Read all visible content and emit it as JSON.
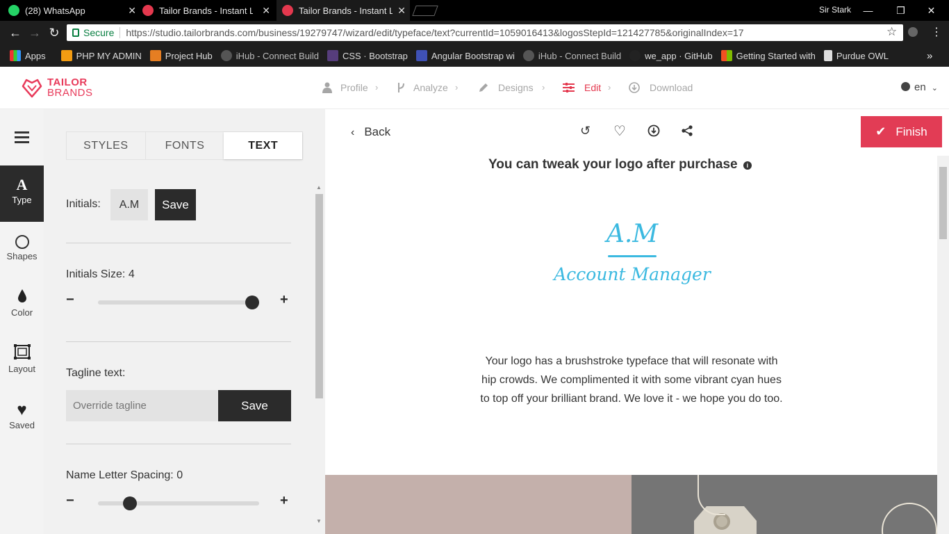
{
  "browser": {
    "tabs": [
      {
        "title": "(28) WhatsApp",
        "badge": "28"
      },
      {
        "title": "Tailor Brands - Instant Logo"
      },
      {
        "title": "Tailor Brands - Instant Logo"
      }
    ],
    "user": "Sir Stark",
    "secure_label": "Secure",
    "url": "https://studio.tailorbrands.com/business/19279747/wizard/edit/typeface/text?currentId=1059016413&logosStepId=121427785&originalIndex=17",
    "bookmarks": [
      "Apps",
      "PHP MY ADMIN",
      "Project Hub",
      "iHub - Connect Build",
      "CSS · Bootstrap",
      "Angular Bootstrap wi",
      "iHub - Connect Build",
      "we_app · GitHub",
      "Getting Started with",
      "Purdue OWL"
    ],
    "more": "»"
  },
  "header": {
    "logo_line1": "TAILOR",
    "logo_line2": "BRANDS",
    "steps": [
      "Profile",
      "Analyze",
      "Designs",
      "Edit",
      "Download"
    ],
    "active_step": "Edit",
    "language": "en",
    "accent_color": "#e4384e"
  },
  "sidebar": {
    "items": [
      {
        "label": "Type",
        "icon": "type-icon"
      },
      {
        "label": "Shapes",
        "icon": "circle-icon"
      },
      {
        "label": "Color",
        "icon": "drop-icon"
      },
      {
        "label": "Layout",
        "icon": "layout-icon"
      },
      {
        "label": "Saved",
        "icon": "heart-icon"
      }
    ]
  },
  "panel": {
    "tabs": [
      "STYLES",
      "FONTS",
      "TEXT"
    ],
    "active_tab": "TEXT",
    "initials_label": "Initials:",
    "initials_value": "A.M",
    "save_label": "Save",
    "initials_size_label": "Initials Size: 4",
    "initials_size_fraction": 1.0,
    "tagline_label": "Tagline text:",
    "tagline_placeholder": "Override tagline",
    "letter_spacing_label": "Name Letter Spacing: 0",
    "letter_spacing_fraction": 0.2,
    "minus": "−",
    "plus": "+"
  },
  "main": {
    "back_label": "Back",
    "finish_label": "Finish",
    "tweak_text": "You can tweak your logo after purchase",
    "logo_initials": "A.M",
    "logo_tagline": "Account Manager",
    "logo_color": "#3bb9e0",
    "description": "Your logo has a brushstroke typeface that will resonate with hip crowds. We complimented it with some vibrant cyan hues to top off your brilliant brand. We love it - we hope you do too."
  }
}
